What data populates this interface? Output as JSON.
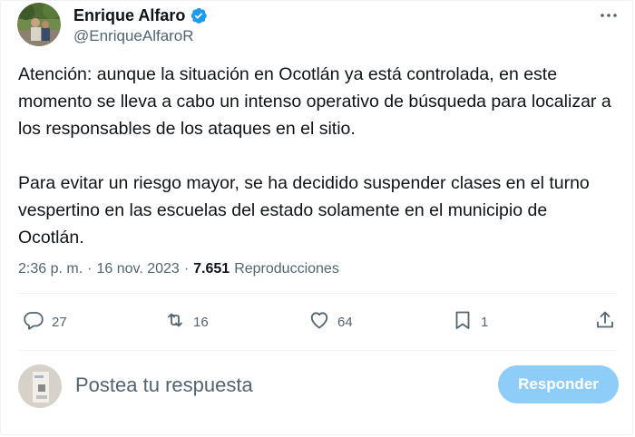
{
  "author": {
    "display_name": "Enrique Alfaro",
    "handle": "@EnriqueAlfaroR",
    "verified": true
  },
  "tweet": {
    "paragraphs": [
      "Atención: aunque la situación en Ocotlán ya está controlada, en este momento se lleva a cabo un intenso operativo de búsqueda para localizar a los responsables de los ataques en el sitio.",
      "Para evitar un riesgo mayor, se ha decidido suspender clases en el turno vespertino en las escuelas del estado solamente en el municipio de Ocotlán."
    ],
    "time": "2:36 p. m.",
    "separator": "·",
    "date": "16 nov. 2023",
    "views": "7.651",
    "views_label": "Reproducciones"
  },
  "actions": {
    "replies": "27",
    "retweets": "16",
    "likes": "64",
    "bookmarks": "1"
  },
  "reply_box": {
    "placeholder": "Postea tu respuesta",
    "button_label": "Responder"
  },
  "colors": {
    "text": "#0f1419",
    "secondary": "#536471",
    "verified": "#1d9bf0",
    "button_disabled": "#8ecdf8"
  },
  "icons": {
    "more": "more-dots-icon",
    "reply": "reply-bubble-icon",
    "retweet": "retweet-icon",
    "like": "heart-icon",
    "bookmark": "bookmark-icon",
    "share": "share-upload-icon",
    "verified": "verified-badge-icon"
  }
}
